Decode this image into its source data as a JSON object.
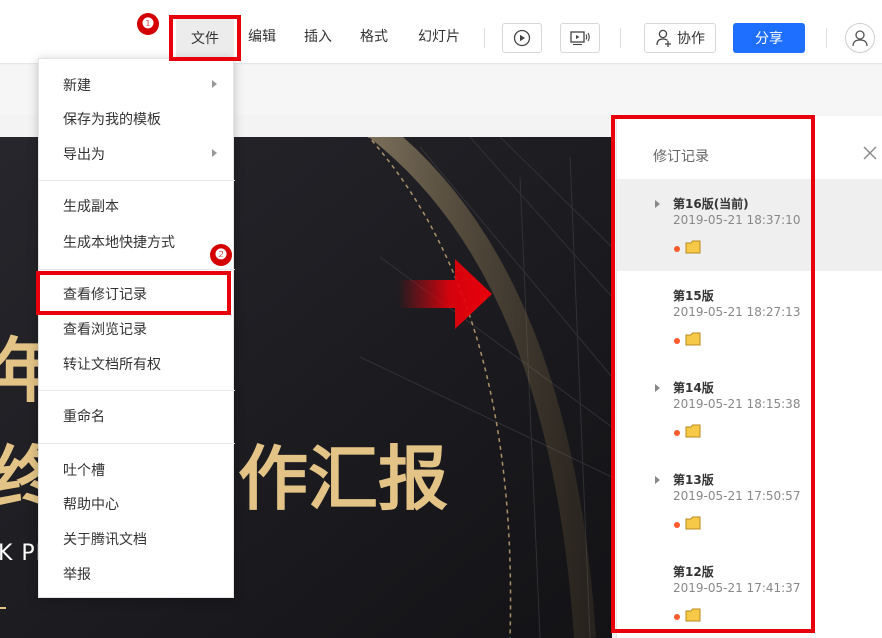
{
  "toolbar": {
    "menus": [
      "文件",
      "编辑",
      "插入",
      "格式",
      "幻灯片"
    ],
    "collab_label": "协作",
    "share_label": "分享",
    "present_icon": "play-circle-icon",
    "presenter_icon": "presenter-view-icon",
    "collab_icon": "add-person-icon",
    "avatar_icon": "user-avatar-icon"
  },
  "file_menu": {
    "items": [
      {
        "label": "新建",
        "submenu": true
      },
      {
        "label": "保存为我的模板",
        "submenu": false
      },
      {
        "label": "导出为",
        "submenu": true
      },
      {
        "label": "生成副本",
        "submenu": false
      },
      {
        "label": "生成本地快捷方式",
        "submenu": false
      },
      {
        "label": "查看修订记录",
        "submenu": false
      },
      {
        "label": "查看浏览记录",
        "submenu": false
      },
      {
        "label": "转让文档所有权",
        "submenu": false
      },
      {
        "label": "重命名",
        "submenu": false
      },
      {
        "label": "吐个槽",
        "submenu": false
      },
      {
        "label": "帮助中心",
        "submenu": false
      },
      {
        "label": "关于腾讯文档",
        "submenu": false
      },
      {
        "label": "举报",
        "submenu": false
      }
    ]
  },
  "annotations": {
    "step1": "❶",
    "step2": "❷"
  },
  "slide": {
    "title_line1": "年",
    "title_line2": "终",
    "title_main": "作汇报",
    "subtitle": "K PI"
  },
  "revision_panel": {
    "title": "修订记录",
    "versions": [
      {
        "version": "第16版(当前)",
        "time": "2019-05-21 18:37:10",
        "expandable": true,
        "current": true
      },
      {
        "version": "第15版",
        "time": "2019-05-21 18:27:13",
        "expandable": false,
        "current": false
      },
      {
        "version": "第14版",
        "time": "2019-05-21 18:15:38",
        "expandable": true,
        "current": false
      },
      {
        "version": "第13版",
        "time": "2019-05-21 17:50:57",
        "expandable": true,
        "current": false
      },
      {
        "version": "第12版",
        "time": "2019-05-21 17:41:37",
        "expandable": false,
        "current": false
      }
    ]
  },
  "colors": {
    "accent_blue": "#1e6fff",
    "annotation_red": "#e8000b",
    "slide_gold": "#e3c486",
    "slide_dark": "#1d1d22"
  }
}
